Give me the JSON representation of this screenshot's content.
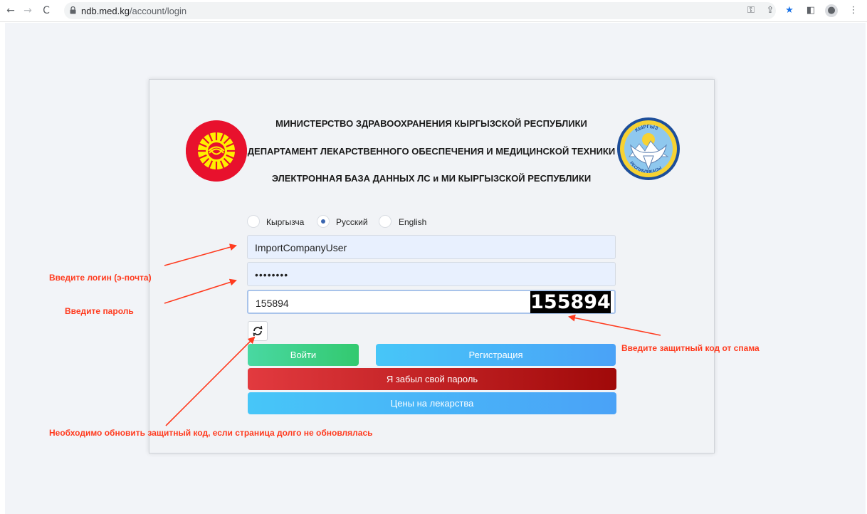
{
  "browser": {
    "url_domain": "ndb.med.kg",
    "url_path": "/account/login"
  },
  "header": {
    "line1": "МИНИСТЕРСТВО ЗДРАВООХРАНЕНИЯ КЫРГЫЗСКОЙ РЕСПУБЛИКИ",
    "line2": "ДЕПАРТАМЕНТ ЛЕКАРСТВЕННОГО ОБЕСПЕЧЕНИЯ И МЕДИЦИНСКОЙ ТЕХНИКИ",
    "line3": "ЭЛЕКТРОННАЯ БАЗА ДАННЫХ ЛС и МИ КЫРГЫЗСКОЙ РЕСПУБЛИКИ"
  },
  "emblem": {
    "top_text": "КЫРГЫЗ",
    "bottom_text": "РЕСПУБЛИКАСЫ"
  },
  "languages": [
    {
      "label": "Кыргызча",
      "checked": false
    },
    {
      "label": "Русский",
      "checked": true
    },
    {
      "label": "English",
      "checked": false
    }
  ],
  "form": {
    "login_value": "ImportCompanyUser",
    "password_value": "••••••••",
    "captcha_value": "155894",
    "captcha_image_text": "155894"
  },
  "buttons": {
    "login": "Войти",
    "register": "Регистрация",
    "forgot": "Я забыл свой пароль",
    "prices": "Цены на лекарства"
  },
  "annotations": {
    "login_hint": "Введите логин (э-почта)",
    "password_hint": "Введите пароль",
    "captcha_hint": "Введите защитный код от спама",
    "refresh_hint": "Необходимо обновить защитный код, если страница долго не обновлялась"
  },
  "colors": {
    "annotation": "#ff3b1f",
    "login_button": "#3ccf85",
    "register_button": "#4ab6f8",
    "forgot_button": "#c61e22",
    "flag": "#e8112d"
  }
}
